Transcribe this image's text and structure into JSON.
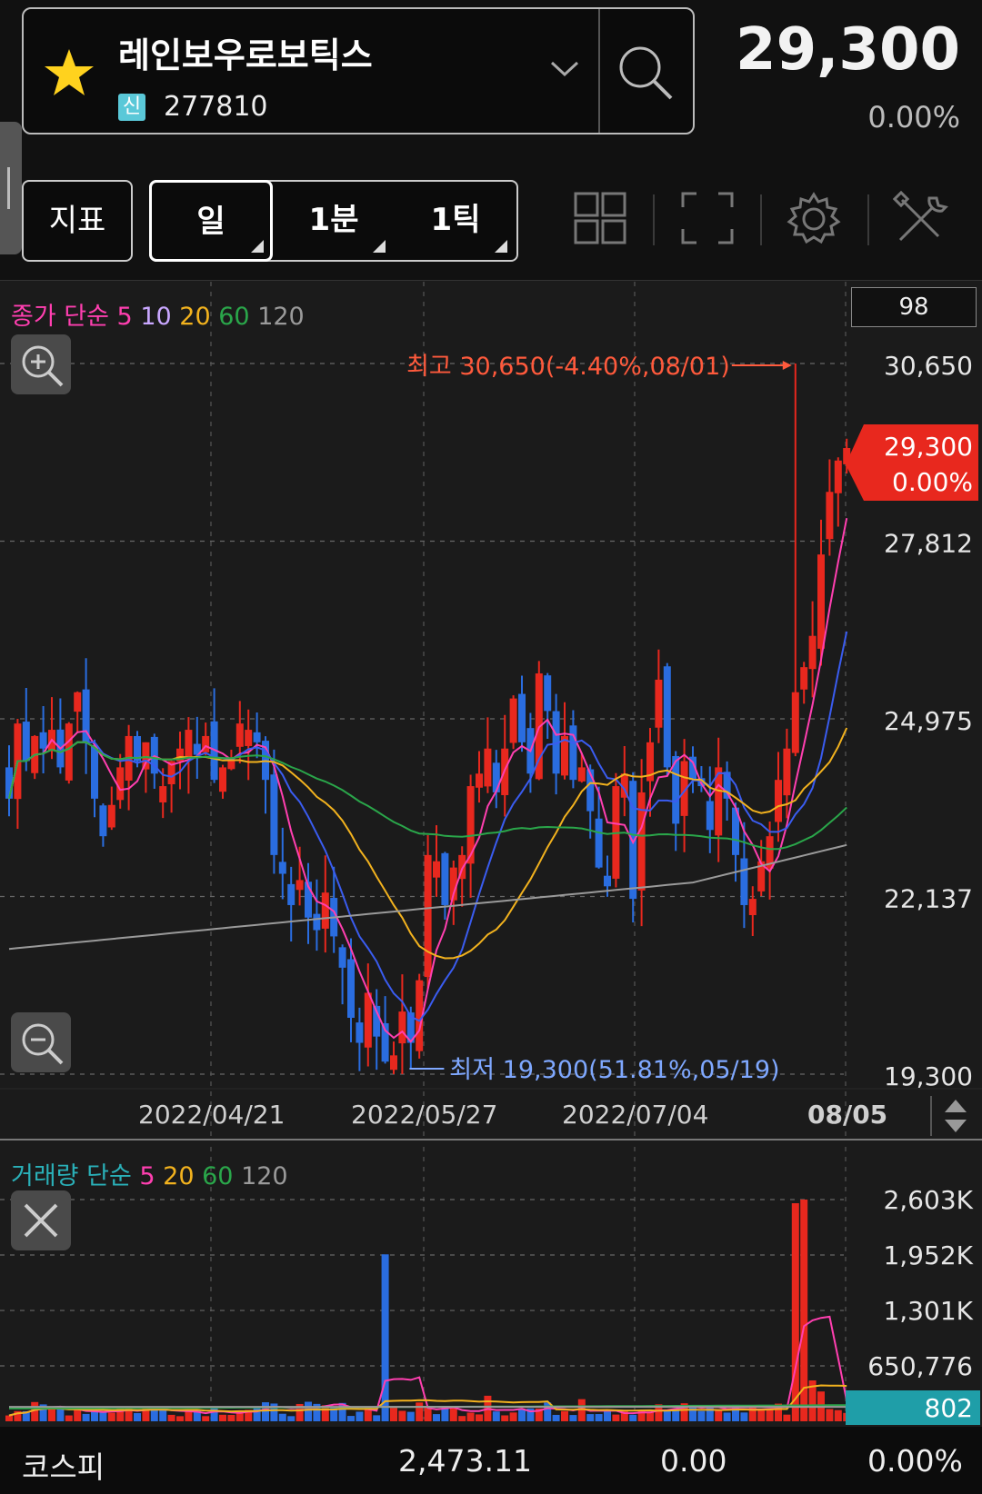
{
  "header": {
    "stock_name": "레인보우로보틱스",
    "market_badge": "신",
    "stock_code": "277810",
    "price": "29,300",
    "change_pct": "0.00%",
    "favorite_icon": "star-icon",
    "dropdown_icon": "chevron-down-icon",
    "search_icon": "search-icon"
  },
  "toolbar": {
    "indicator_label": "지표",
    "period_day": "일",
    "period_minute": "1분",
    "period_tick": "1틱",
    "icons": [
      "grid-layout-icon",
      "fullscreen-icon",
      "gear-icon",
      "tools-icon"
    ]
  },
  "price_panel": {
    "legend_prefix": "종가 단순",
    "ma_labels": [
      "5",
      "10",
      "20",
      "60",
      "120"
    ],
    "candle_count_box": "98",
    "y_labels": [
      "30,650",
      "27,812",
      "24,975",
      "22,137",
      "19,300"
    ],
    "current_tag_price": "29,300",
    "current_tag_change": "0.00%",
    "high_annotation": "최고 30,650(-4.40%,08/01)",
    "low_annotation": "최저 19,300(51.81%,05/19)",
    "x_labels": [
      "2022/04/21",
      "2022/05/27",
      "2022/07/04",
      "08/05"
    ]
  },
  "volume_panel": {
    "legend_prefix": "거래량 단순",
    "ma_labels": [
      "5",
      "20",
      "60",
      "120"
    ],
    "y_labels": [
      "2,603K",
      "1,952K",
      "1,301K",
      "650,776"
    ],
    "current_volume": "802"
  },
  "footer": {
    "index_name": "코스피",
    "index_value": "2,473.11",
    "index_change": "0.00",
    "index_change_pct": "0.00%"
  },
  "colors": {
    "up": "#e8281e",
    "down": "#2a6de0",
    "ma5": "#ff3fb0",
    "ma10": "#3a5cf0",
    "ma20": "#f2b21e",
    "ma60": "#2aa64a",
    "ma120": "#9a9a9a",
    "high_text": "#ff5a3c",
    "low_text": "#7fa8ff",
    "volume_tag": "#1f9ea8"
  },
  "chart_data": {
    "type": "candlestick",
    "y_range": [
      19300,
      30650
    ],
    "anchors": [
      {
        "date": "2022/04/21"
      },
      {
        "date": "2022/05/27"
      },
      {
        "date": "2022/07/04"
      },
      {
        "date": "08/05"
      }
    ],
    "high": {
      "value": 30650,
      "date": "08/01"
    },
    "low": {
      "value": 19300,
      "date": "05/19"
    },
    "close": [
      23700,
      24900,
      24300,
      24700,
      24500,
      24800,
      24200,
      24900,
      25400,
      24600,
      23700,
      23100,
      23600,
      24200,
      24700,
      24300,
      24600,
      24100,
      23900,
      24300,
      24500,
      24800,
      24400,
      24700,
      24000,
      24200,
      24300,
      24900,
      24800,
      24600,
      24000,
      22800,
      22500,
      22000,
      22400,
      21800,
      21600,
      22200,
      21500,
      21000,
      20200,
      19800,
      20600,
      19900,
      19500,
      19600,
      20300,
      19800,
      20800,
      22800,
      22700,
      22000,
      22600,
      22800,
      23900,
      24100,
      24500,
      23800,
      24500,
      25300,
      24600,
      24100,
      25700,
      25100,
      24100,
      24700,
      24000,
      24200,
      23500,
      22600,
      22300,
      23900,
      24100,
      22100,
      23800,
      24600,
      25600,
      24200,
      23300,
      24300,
      24000,
      23900,
      23200,
      24200,
      23700,
      22800,
      22000,
      22100,
      22700,
      23100,
      24000,
      24500,
      25400,
      25800,
      26300,
      27600,
      28600,
      29100,
      29300
    ],
    "volume_scale_k": [
      2603,
      1952,
      1301,
      650.776
    ]
  }
}
